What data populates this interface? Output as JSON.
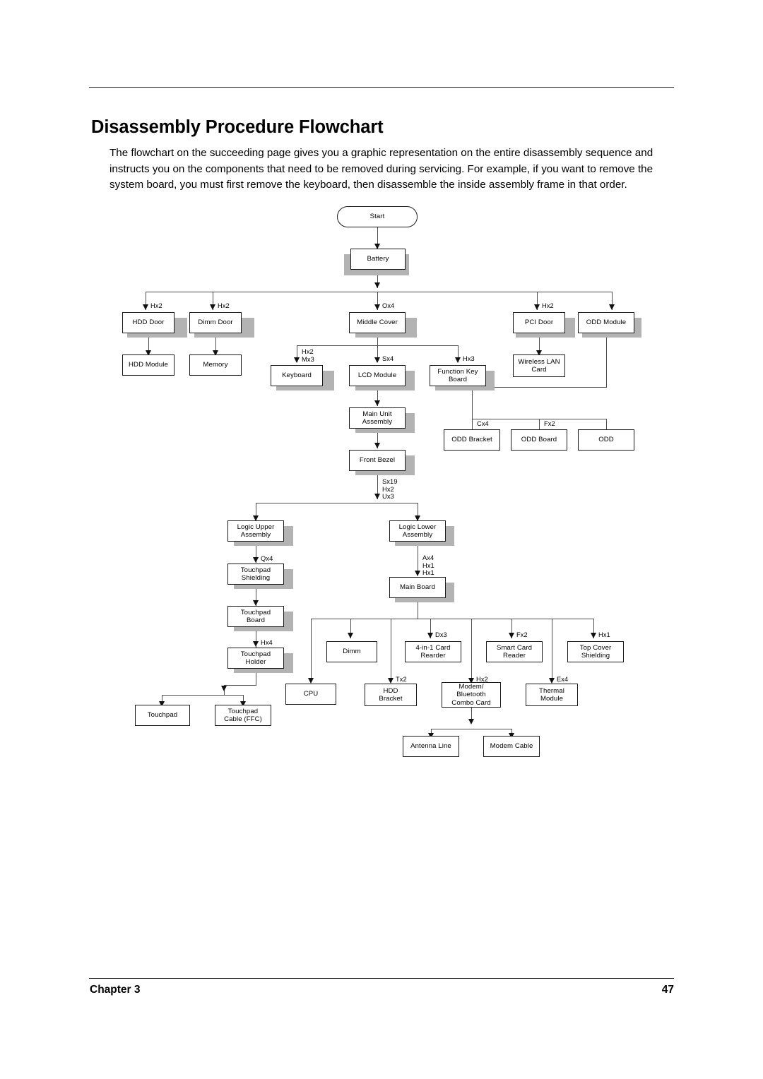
{
  "document": {
    "title": "Disassembly Procedure Flowchart",
    "intro": "The flowchart on the succeeding page gives you a graphic representation on the entire disassembly sequence and instructs you on the components that need to be removed during servicing. For example, if you want to remove the system board, you must first remove the keyboard, then disassemble the inside assembly frame in that order.",
    "footer": {
      "chapter": "Chapter 3",
      "page_number": "47"
    }
  },
  "flowchart": {
    "type": "diagram",
    "nodes": [
      {
        "id": "start",
        "label": "Start",
        "shape": "terminator"
      },
      {
        "id": "battery",
        "label": "Battery",
        "shape": "process"
      },
      {
        "id": "hdd_door",
        "label": "HDD Door",
        "shape": "process"
      },
      {
        "id": "dimm_door",
        "label": "Dimm Door",
        "shape": "process"
      },
      {
        "id": "middle_cover",
        "label": "Middle Cover",
        "shape": "process"
      },
      {
        "id": "pci_door",
        "label": "PCI Door",
        "shape": "process"
      },
      {
        "id": "odd_module",
        "label": "ODD Module",
        "shape": "process"
      },
      {
        "id": "hdd_module",
        "label": "HDD Module",
        "shape": "process"
      },
      {
        "id": "memory",
        "label": "Memory",
        "shape": "process"
      },
      {
        "id": "keyboard",
        "label": "Keyboard",
        "shape": "process"
      },
      {
        "id": "lcd_module",
        "label": "LCD Module",
        "shape": "process"
      },
      {
        "id": "function_key",
        "label": "Function Key\nBoard",
        "shape": "process"
      },
      {
        "id": "wireless_lan",
        "label": "Wireless LAN\nCard",
        "shape": "process"
      },
      {
        "id": "main_unit",
        "label": "Main Unit\nAssembly",
        "shape": "process"
      },
      {
        "id": "odd_bracket",
        "label": "ODD Bracket",
        "shape": "process"
      },
      {
        "id": "odd_board",
        "label": "ODD Board",
        "shape": "process"
      },
      {
        "id": "odd",
        "label": "ODD",
        "shape": "process"
      },
      {
        "id": "front_bezel",
        "label": "Front Bezel",
        "shape": "process"
      },
      {
        "id": "logic_upper",
        "label": "Logic Upper\nAssembly",
        "shape": "process"
      },
      {
        "id": "logic_lower",
        "label": "Logic Lower\nAssembly",
        "shape": "process"
      },
      {
        "id": "touchpad_shield",
        "label": "Touchpad\nShielding",
        "shape": "process"
      },
      {
        "id": "main_board",
        "label": "Main Board",
        "shape": "process"
      },
      {
        "id": "touchpad_board",
        "label": "Touchpad\nBoard",
        "shape": "process"
      },
      {
        "id": "dimm",
        "label": "Dimm",
        "shape": "process"
      },
      {
        "id": "card_reader",
        "label": "4-in-1 Card\nRearder",
        "shape": "process"
      },
      {
        "id": "smart_card",
        "label": "Smart Card\nReader",
        "shape": "process"
      },
      {
        "id": "top_cover",
        "label": "Top Cover\nShielding",
        "shape": "process"
      },
      {
        "id": "touchpad_holder",
        "label": "Touchpad\nHolder",
        "shape": "process"
      },
      {
        "id": "cpu",
        "label": "CPU",
        "shape": "process"
      },
      {
        "id": "hdd_bracket",
        "label": "HDD\nBracket",
        "shape": "process"
      },
      {
        "id": "modem_bt",
        "label": "Modem/\nBluetooth\nCombo Card",
        "shape": "process"
      },
      {
        "id": "thermal_module",
        "label": "Thermal\nModule",
        "shape": "process"
      },
      {
        "id": "touchpad",
        "label": "Touchpad",
        "shape": "process"
      },
      {
        "id": "touchpad_cable",
        "label": "Touchpad\nCable (FFC)",
        "shape": "process"
      },
      {
        "id": "antenna_line",
        "label": "Antenna Line",
        "shape": "process"
      },
      {
        "id": "modem_cable",
        "label": "Modem Cable",
        "shape": "process"
      }
    ],
    "edge_labels": [
      {
        "id": "l_hdd_door",
        "text": "Hx2"
      },
      {
        "id": "l_dimm_door",
        "text": "Hx2"
      },
      {
        "id": "l_middle",
        "text": "Ox4"
      },
      {
        "id": "l_pci_door",
        "text": "Hx2"
      },
      {
        "id": "l_keyboard",
        "text": "Hx2\nMx3"
      },
      {
        "id": "l_lcd",
        "text": "Sx4"
      },
      {
        "id": "l_funckey",
        "text": "Hx3"
      },
      {
        "id": "l_oddbracket",
        "text": "Cx4"
      },
      {
        "id": "l_oddboard",
        "text": "Fx2"
      },
      {
        "id": "l_frontbezel",
        "text": "Sx19\nHx2\nUx3"
      },
      {
        "id": "l_touchshield",
        "text": "Qx4"
      },
      {
        "id": "l_mainboard",
        "text": "Ax4\nHx1\nHx1"
      },
      {
        "id": "l_touchholder",
        "text": "Hx4"
      },
      {
        "id": "l_cardreader",
        "text": "Dx3"
      },
      {
        "id": "l_smartcard",
        "text": "Fx2"
      },
      {
        "id": "l_topcover",
        "text": "Hx1"
      },
      {
        "id": "l_hddbracket",
        "text": "Tx2"
      },
      {
        "id": "l_modembt",
        "text": "Hx2"
      },
      {
        "id": "l_thermal",
        "text": "Ex4"
      }
    ],
    "colors": {
      "box_border": "#1a1a1a",
      "box_fill": "#ffffff",
      "shadow": "#b3b3b3",
      "connector": "#4d4d4d",
      "text": "#000000"
    }
  }
}
